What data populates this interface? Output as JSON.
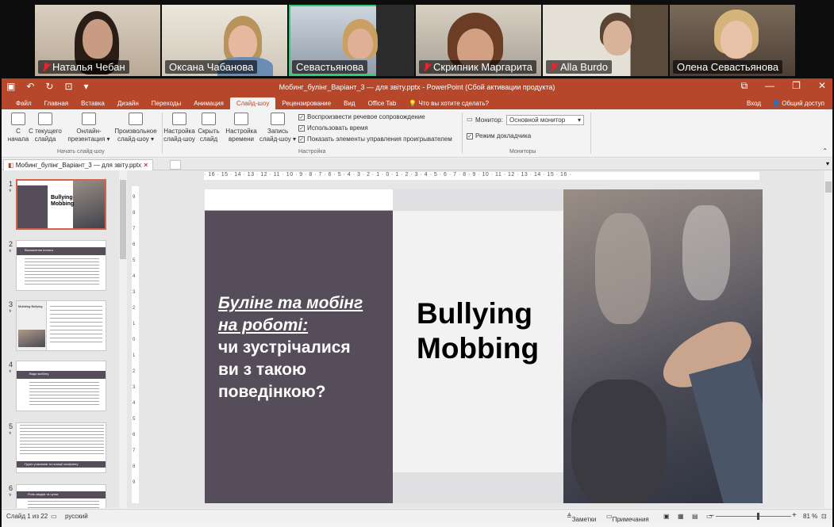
{
  "participants": [
    {
      "name": "Наталья Чебан",
      "muted": true
    },
    {
      "name": "Оксана Чабанова",
      "muted": false
    },
    {
      "name": "Севастьянова",
      "muted": false,
      "active_speaker": true
    },
    {
      "name": "Скрипник Маргарита",
      "muted": true
    },
    {
      "name": "Alla Burdo",
      "muted": true
    },
    {
      "name": "Олена Севастьянова",
      "muted": false
    }
  ],
  "window": {
    "title": "Мобинг_булінг_Варіант_3 — для звіту.pptx - PowerPoint (Сбой активации продукта)"
  },
  "menu": {
    "tabs": [
      "Файл",
      "Главная",
      "Вставка",
      "Дизайн",
      "Переходы",
      "Анимация",
      "Слайд-шоу",
      "Рецензирование",
      "Вид",
      "Office Tab"
    ],
    "active_tab": "Слайд-шоу",
    "tell_me": "Что вы хотите сделать?",
    "login": "Вход",
    "share": "Общий доступ"
  },
  "ribbon": {
    "from_start": [
      "С",
      "начала"
    ],
    "from_current": [
      "С текущего",
      "слайда"
    ],
    "online": [
      "Онлайн-",
      "презентация"
    ],
    "custom": [
      "Произвольное",
      "слайд-шоу"
    ],
    "group_start": "Начать слайд-шоу",
    "setup": [
      "Настройка",
      "слайд-шоу"
    ],
    "hide": [
      "Скрыть",
      "слайд"
    ],
    "timing": [
      "Настройка",
      "времени"
    ],
    "record": [
      "Запись",
      "слайд-шоу"
    ],
    "check1": "Воспроизвести речевое сопровождение",
    "check2": "Использовать время",
    "check3": "Показать элементы управления проигрывателем",
    "group_setup": "Настройка",
    "monitor_label": "Монитор:",
    "monitor_value": "Основной монитор",
    "presenter": "Режим докладчика",
    "group_monitors": "Мониторы"
  },
  "doc_tab": "Мобинг_булінг_Варіант_3 — для звіту.pptx",
  "thumbnails": [
    {
      "num": "1",
      "title": "Bullying Mobbing"
    },
    {
      "num": "2",
      "title": "Визначення понятя"
    },
    {
      "num": "3",
      "title": "Mobbing Bullying"
    },
    {
      "num": "4",
      "title": "Види мобінгу"
    },
    {
      "num": "5",
      "title": "Групи учасників та позиції конфлікту"
    },
    {
      "num": "6",
      "title": "Роль свідків та чутки"
    }
  ],
  "slide": {
    "title_line1": "Булінг та мобінг",
    "title_line2": "на роботі:",
    "title_line3": "чи зустрічалися",
    "title_line4": "ви з такою",
    "title_line5": "поведінкою?",
    "big1": "Bullying",
    "big2": "Mobbing"
  },
  "ruler": {
    "h": "· 16 · 15 · 14 · 13 · 12 · 11 · 10 · 9 · 8 · 7 · 6 · 5 · 4 · 3 · 2 · 1 · 0 · 1 · 2 · 3 · 4 · 5 · 6 · 7 · 8 · 9 · 10 · 11 · 12 · 13 · 14 · 15 · 16 ·",
    "v": [
      "9",
      "8",
      "7",
      "6",
      "5",
      "4",
      "3",
      "2",
      "1",
      "0",
      "1",
      "2",
      "3",
      "4",
      "5",
      "6",
      "7",
      "8",
      "9"
    ]
  },
  "status": {
    "slide": "Слайд 1 из 22",
    "lang": "русский",
    "notes": "Заметки",
    "comments": "Примечания",
    "zoom": "81 %"
  }
}
